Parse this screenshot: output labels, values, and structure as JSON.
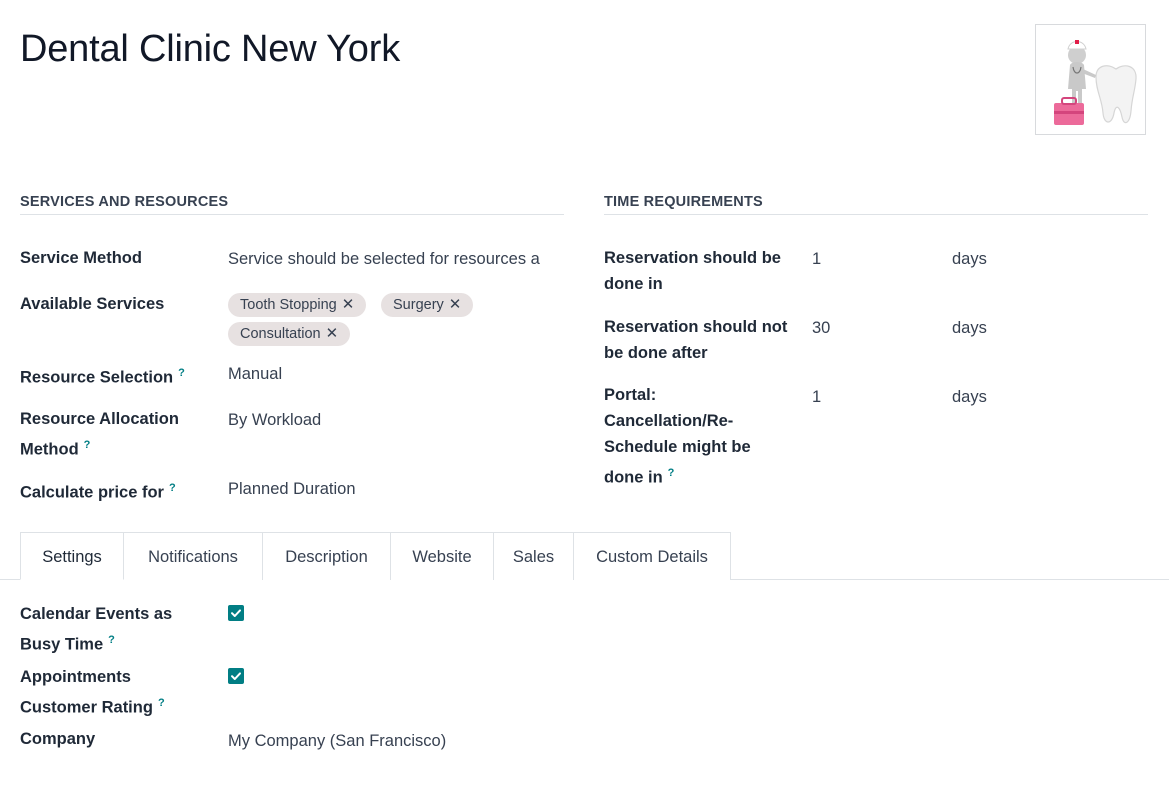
{
  "record": {
    "title": "Dental Clinic New York"
  },
  "sections": {
    "services_title": "SERVICES AND RESOURCES",
    "time_title": "TIME REQUIREMENTS"
  },
  "services": {
    "service_method_label": "Service Method",
    "service_method_value": "Service should be selected for resources a",
    "available_services_label": "Available Services",
    "tags": [
      "Tooth Stopping",
      "Surgery",
      "Consultation"
    ],
    "resource_selection_label": "Resource Selection",
    "resource_selection_value": "Manual",
    "allocation_label_line1": "Resource Allocation",
    "allocation_label_line2": "Method",
    "allocation_value": "By Workload",
    "price_label": "Calculate price for",
    "price_value": "Planned Duration"
  },
  "time": {
    "row1_label_line1": "Reservation should be",
    "row1_label_line2": "done in",
    "row1_value": "1",
    "row1_unit": "days",
    "row2_label_line1": "Reservation should not",
    "row2_label_line2": "be done after",
    "row2_value": "30",
    "row2_unit": "days",
    "row3_label_line1": "Portal:",
    "row3_label_line2": "Cancellation/Re-",
    "row3_label_line3": "Schedule might be",
    "row3_label_line4": "done in",
    "row3_value": "1",
    "row3_unit": "days"
  },
  "help_mark": "?",
  "remove_mark": "✕",
  "tabs": [
    "Settings",
    "Notifications",
    "Description",
    "Website",
    "Sales",
    "Custom Details"
  ],
  "settings": {
    "busy_label_line1": "Calendar Events as",
    "busy_label_line2": "Busy Time",
    "busy_checked": true,
    "rating_label_line1": "Appointments",
    "rating_label_line2": "Customer Rating",
    "rating_checked": true,
    "company_label": "Company",
    "company_value": "My Company (San Francisco)"
  },
  "colors": {
    "accent": "#017e84",
    "tag_bg": "#e7e1e1"
  }
}
